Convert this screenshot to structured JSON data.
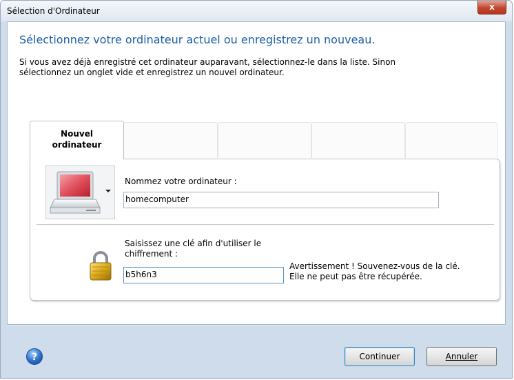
{
  "window": {
    "title": "Sélection d'Ordinateur",
    "close_label": "x"
  },
  "header": {
    "heading": "Sélectionnez votre ordinateur actuel ou enregistrez un nouveau.",
    "intro_line1": "Si vous avez déjà enregistré cet ordinateur auparavant, sélectionnez-le dans la liste. Sinon",
    "intro_line2": "sélectionnez un onglet vide et enregistrez un nouvel ordinateur."
  },
  "tabs": {
    "active_line1": "Nouvel",
    "active_line2": "ordinateur",
    "empty_tabs": [
      "",
      "",
      "",
      ""
    ]
  },
  "computer": {
    "name_label": "Nommez votre ordinateur :",
    "name_value": "homecomputer",
    "icon": "computer-icon"
  },
  "encryption": {
    "key_label_line1": "Saisissez une clé afin d'utiliser le",
    "key_label_line2": "chiffrement :",
    "key_value": "b5h6n3",
    "warning_line1": "Avertissement ! Souvenez-vous de la clé.",
    "warning_line2": "Elle ne peut pas être récupérée.",
    "icon": "lock-icon"
  },
  "footer": {
    "help_icon": "help-icon",
    "continue_label": "Continuer",
    "cancel_label": "Annuler"
  },
  "colors": {
    "accent_heading": "#1c5fa8",
    "close_button": "#c4452d",
    "help_blue": "#2f6fc9",
    "lock_gold": "#c99a17"
  }
}
